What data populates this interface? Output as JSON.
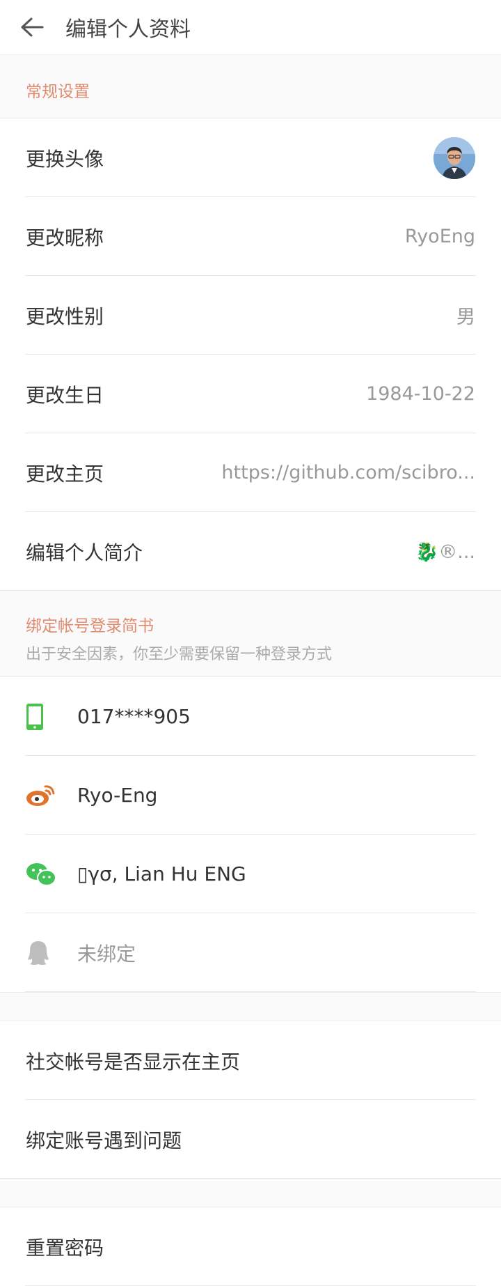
{
  "header": {
    "title": "编辑个人资料"
  },
  "general": {
    "title": "常规设置",
    "rows": [
      {
        "label": "更换头像"
      },
      {
        "label": "更改昵称",
        "value": "RyoEng"
      },
      {
        "label": "更改性别",
        "value": "男"
      },
      {
        "label": "更改生日",
        "value": "1984-10-22"
      },
      {
        "label": "更改主页",
        "value": "https://github.com/scibro..."
      },
      {
        "label": "编辑个人简介",
        "value": "🐉®..."
      }
    ]
  },
  "binding": {
    "title": "绑定帐号登录简书",
    "subtitle": "出于安全因素，你至少需要保留一种登录方式",
    "items": [
      {
        "icon": "phone-icon",
        "text": "017****905",
        "color": "#4cc04c"
      },
      {
        "icon": "weibo-icon",
        "text": "Ryo-Eng",
        "color": "#e0722c"
      },
      {
        "icon": "wechat-icon",
        "text": "▯γσ, Lian Hu ENG",
        "color": "#44c25a"
      },
      {
        "icon": "qq-icon",
        "text": "未绑定",
        "color": "#bdbdbd"
      }
    ]
  },
  "social": {
    "rows": [
      {
        "label": "社交帐号是否显示在主页"
      },
      {
        "label": "绑定账号遇到问题"
      }
    ]
  },
  "security": {
    "rows": [
      {
        "label": "重置密码"
      }
    ]
  },
  "colors": {
    "accent": "#e08a6e",
    "divider": "#e8e8e8",
    "section_bg": "#fafafa"
  }
}
